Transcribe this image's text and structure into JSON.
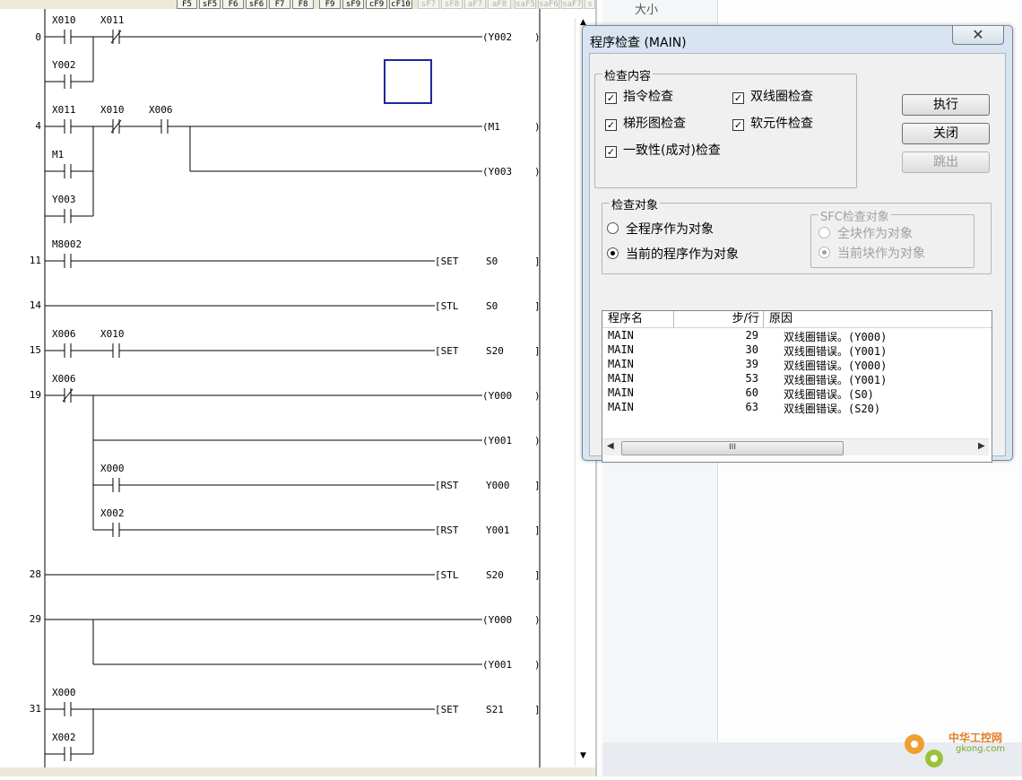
{
  "toolbar": {
    "function_keys": [
      {
        "label": "F5",
        "enabled": true
      },
      {
        "label": "sF5",
        "enabled": true
      },
      {
        "label": "F6",
        "enabled": true
      },
      {
        "label": "sF6",
        "enabled": true
      },
      {
        "label": "F7",
        "enabled": true
      },
      {
        "label": "F8",
        "enabled": true
      },
      {
        "label": "F9",
        "enabled": true
      },
      {
        "label": "sF9",
        "enabled": true
      },
      {
        "label": "cF9",
        "enabled": true
      },
      {
        "label": "cF10",
        "enabled": true
      },
      {
        "label": "sF7",
        "enabled": false
      },
      {
        "label": "sF8",
        "enabled": false
      },
      {
        "label": "aF7",
        "enabled": false
      },
      {
        "label": "aF8",
        "enabled": false
      },
      {
        "label": "saF5",
        "enabled": false
      },
      {
        "label": "saF6",
        "enabled": false
      },
      {
        "label": "saF7",
        "enabled": false
      },
      {
        "label": "s",
        "enabled": false
      }
    ]
  },
  "right_panel": {
    "size_label": "大小"
  },
  "ladder": {
    "step_numbers": [
      "0",
      "4",
      "11",
      "14",
      "15",
      "19",
      "28",
      "29",
      "31"
    ],
    "contacts": [
      "X010",
      "X011",
      "Y002",
      "X011",
      "X010",
      "X006",
      "M1",
      "Y003",
      "M8002",
      "X006",
      "X010",
      "X006",
      "X000",
      "X002",
      "X000",
      "X002"
    ],
    "coils": [
      "(Y002",
      "(M1",
      "(Y003",
      "(Y000",
      "(Y001",
      "(Y000",
      "(Y001"
    ],
    "instructions": [
      {
        "op": "[SET",
        "arg": "S0"
      },
      {
        "op": "[STL",
        "arg": "S0"
      },
      {
        "op": "[SET",
        "arg": "S20"
      },
      {
        "op": "[RST",
        "arg": "Y000"
      },
      {
        "op": "[RST",
        "arg": "Y001"
      },
      {
        "op": "[STL",
        "arg": "S20"
      },
      {
        "op": "[SET",
        "arg": "S21"
      }
    ]
  },
  "dialog": {
    "title": "程序检查 (MAIN)",
    "close_glyph": "✕",
    "check_content": {
      "title": "检查内容",
      "items": [
        {
          "label": "指令检查",
          "checked": true
        },
        {
          "label": "双线圈检查",
          "checked": true
        },
        {
          "label": "梯形图检查",
          "checked": true
        },
        {
          "label": "软元件检查",
          "checked": true
        },
        {
          "label": "一致性(成对)检查",
          "checked": true
        }
      ]
    },
    "buttons": {
      "execute": "执行",
      "close": "关闭",
      "jump": "跳出"
    },
    "check_target": {
      "title": "检查对象",
      "options": [
        {
          "label": "全程序作为对象",
          "selected": false
        },
        {
          "label": "当前的程序作为对象",
          "selected": true
        }
      ],
      "sfc": {
        "title": "SFC检查对象",
        "options": [
          {
            "label": "全块作为对象",
            "selected": false
          },
          {
            "label": "当前块作为对象",
            "selected": true
          }
        ]
      }
    },
    "results": {
      "columns": [
        "程序名",
        "步/行",
        "原因"
      ],
      "rows": [
        {
          "program": "MAIN",
          "step": "29",
          "reason": "双线圈错误。(Y000)"
        },
        {
          "program": "MAIN",
          "step": "30",
          "reason": "双线圈错误。(Y001)"
        },
        {
          "program": "MAIN",
          "step": "39",
          "reason": "双线圈错误。(Y000)"
        },
        {
          "program": "MAIN",
          "step": "53",
          "reason": "双线圈错误。(Y001)"
        },
        {
          "program": "MAIN",
          "step": "60",
          "reason": "双线圈错误。(S0)"
        },
        {
          "program": "MAIN",
          "step": "63",
          "reason": "双线圈错误。(S20)"
        }
      ],
      "scroll_thumb": "III"
    }
  },
  "watermark": {
    "text_cn": "中华工控网",
    "text_url": "gkong.com"
  }
}
